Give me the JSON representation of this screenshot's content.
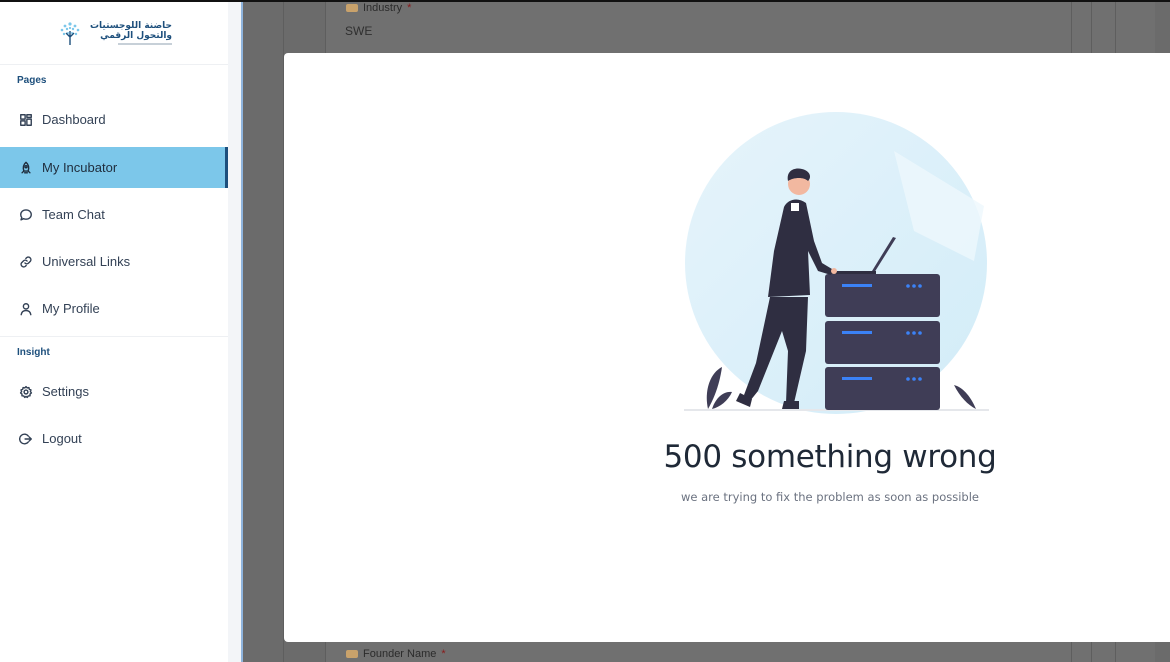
{
  "logo": {
    "line1": "حاضنة اللوجستيات",
    "line2": "والتحول الرقمي"
  },
  "sidebar": {
    "pages_label": "Pages",
    "insight_label": "Insight",
    "items": [
      {
        "label": "Dashboard",
        "icon": "dashboard-icon"
      },
      {
        "label": "My Incubator",
        "icon": "rocket-icon",
        "active": true
      },
      {
        "label": "Team Chat",
        "icon": "chat-bubble-icon"
      },
      {
        "label": "Universal Links",
        "icon": "link-icon"
      },
      {
        "label": "My Profile",
        "icon": "user-icon"
      },
      {
        "label": "Settings",
        "icon": "gear-icon"
      },
      {
        "label": "Logout",
        "icon": "logout-icon"
      }
    ],
    "active_color": "#7cc7ea"
  },
  "background_form": {
    "industry_label": "Industry",
    "industry_value": "SWE",
    "founder_label": "Founder Name",
    "required_mark": "*"
  },
  "modal": {
    "title": "500 something wrong",
    "subtitle": "we are trying to fix the problem as soon as possible",
    "illustration": "server-error-illustration"
  },
  "colors": {
    "accent": "#1d4f7c",
    "overlay": "#6b6b6b",
    "server": "#3f3d56",
    "server_light": "#3b82f6"
  }
}
